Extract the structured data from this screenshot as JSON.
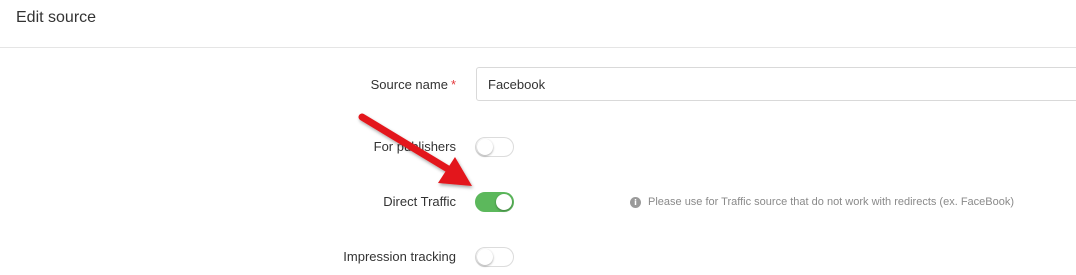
{
  "header": {
    "title": "Edit source"
  },
  "form": {
    "source_name": {
      "label": "Source name",
      "required_mark": "*",
      "value": "Facebook"
    },
    "for_publishers": {
      "label": "For publishers",
      "enabled": false
    },
    "direct_traffic": {
      "label": "Direct Traffic",
      "enabled": true,
      "hint": "Please use for Traffic source that do not work with redirects (ex. FaceBook)",
      "hint_icon": "info-icon"
    },
    "impression_tracking": {
      "label": "Impression tracking",
      "enabled": false
    }
  },
  "colors": {
    "switch_on": "#5cb85c",
    "required": "#e4393c",
    "annotation_arrow": "#e3191b"
  }
}
